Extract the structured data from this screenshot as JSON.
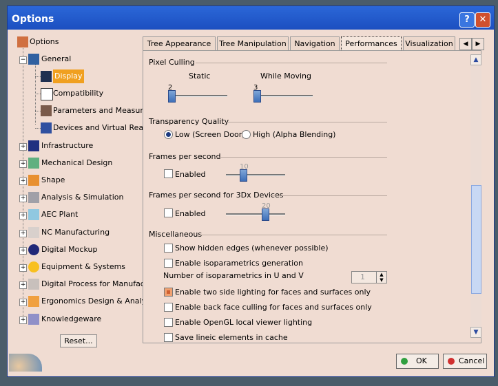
{
  "window": {
    "title": "Options"
  },
  "titlebar": {
    "help_label": "?",
    "close_label": "✕"
  },
  "tree": {
    "root": "Options",
    "general": "General",
    "display": "Display",
    "compatibility": "Compatibility",
    "parameters": "Parameters and Measure",
    "devices": "Devices and Virtual Reality",
    "infrastructure": "Infrastructure",
    "mechanical": "Mechanical Design",
    "shape": "Shape",
    "analysis": "Analysis & Simulation",
    "aec": "AEC Plant",
    "nc": "NC Manufacturing",
    "mockup": "Digital Mockup",
    "equipment": "Equipment & Systems",
    "process": "Digital Process for Manufactur",
    "ergonomics": "Ergonomics Design & Analysis",
    "knowledgeware": "Knowledgeware"
  },
  "reset_label": "Reset...",
  "tabs": [
    "Tree Appearance",
    "Tree Manipulation",
    "Navigation",
    "Performances",
    "Visualization"
  ],
  "active_tab": "Performances",
  "nav": {
    "left": "◀",
    "right": "▶"
  },
  "pixel_culling": {
    "title": "Pixel Culling",
    "static_label": "Static",
    "moving_label": "While Moving",
    "static_value": "2",
    "moving_value": "3"
  },
  "transparency": {
    "title": "Transparency Quality",
    "low_label": "Low (Screen Door)",
    "high_label": "High (Alpha Blending)",
    "selected": "low"
  },
  "fps": {
    "title": "Frames per second",
    "enabled_label": "Enabled",
    "value": "10",
    "enabled": false
  },
  "fps3dx": {
    "title": "Frames per second for 3Dx Devices",
    "enabled_label": "Enabled",
    "value": "20",
    "enabled": false
  },
  "misc": {
    "title": "Miscellaneous",
    "hidden_edges": "Show hidden edges (whenever possible)",
    "iso_gen": "Enable isoparametrics generation",
    "iso_count_label": "Number of isoparametrics in U and V",
    "iso_count_value": "1",
    "two_side": "Enable two side lighting for faces and surfaces only",
    "back_face": "Enable back face culling for faces and surfaces only",
    "opengl": "Enable OpenGL local viewer lighting",
    "lineic": "Save lineic elements in cache",
    "two_side_checked": true
  },
  "buttons": {
    "ok": "OK",
    "cancel": "Cancel"
  },
  "colors": {
    "titlebar": "#2b67d8",
    "dialog_bg": "#f0dcd2",
    "selection": "#f0a020"
  }
}
